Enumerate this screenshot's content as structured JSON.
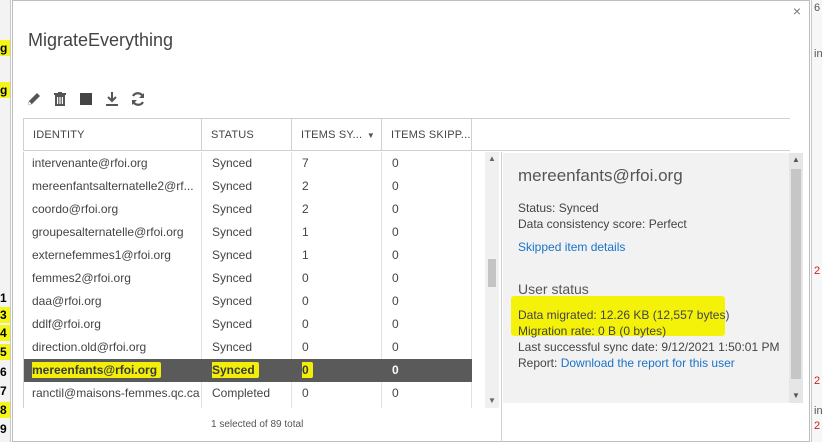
{
  "background": {
    "left_labels": [
      {
        "text": "g",
        "highlight": true
      },
      {
        "text": "g",
        "highlight": true
      },
      {
        "text": "1",
        "highlight": false
      },
      {
        "text": "3",
        "highlight": true
      },
      {
        "text": "4",
        "highlight": true
      },
      {
        "text": "5",
        "highlight": true
      },
      {
        "text": "6",
        "highlight": false
      },
      {
        "text": "7",
        "highlight": false
      },
      {
        "text": "8",
        "highlight": true
      },
      {
        "text": "9",
        "highlight": false
      }
    ],
    "right_labels": [
      "6",
      "in",
      "2",
      "2",
      "in",
      "2"
    ]
  },
  "dialog": {
    "title": "MigrateEverything",
    "close_glyph": "×"
  },
  "toolbar": {
    "icons": [
      "edit-icon",
      "delete-icon",
      "stop-icon",
      "download-icon",
      "refresh-icon"
    ]
  },
  "table": {
    "columns": [
      {
        "label": "IDENTITY"
      },
      {
        "label": "STATUS"
      },
      {
        "label": "ITEMS SY..."
      },
      {
        "label": "ITEMS SKIPP..."
      }
    ],
    "rows": [
      {
        "identity": "intervenante@rfoi.org",
        "status": "Synced",
        "synced": "7",
        "skipped": "0"
      },
      {
        "identity": "mereenfantsalternatelle2@rf...",
        "status": "Synced",
        "synced": "2",
        "skipped": "0"
      },
      {
        "identity": "coordo@rfoi.org",
        "status": "Synced",
        "synced": "2",
        "skipped": "0"
      },
      {
        "identity": "groupesalternatelle@rfoi.org",
        "status": "Synced",
        "synced": "1",
        "skipped": "0"
      },
      {
        "identity": "externefemmes1@rfoi.org",
        "status": "Synced",
        "synced": "1",
        "skipped": "0"
      },
      {
        "identity": "femmes2@rfoi.org",
        "status": "Synced",
        "synced": "0",
        "skipped": "0"
      },
      {
        "identity": "daa@rfoi.org",
        "status": "Synced",
        "synced": "0",
        "skipped": "0"
      },
      {
        "identity": "ddlf@rfoi.org",
        "status": "Synced",
        "synced": "0",
        "skipped": "0"
      },
      {
        "identity": "direction.old@rfoi.org",
        "status": "Synced",
        "synced": "0",
        "skipped": "0"
      },
      {
        "identity": "mereenfants@rfoi.org",
        "status": "Synced",
        "synced": "0",
        "skipped": "0",
        "selected": true
      },
      {
        "identity": "ranctil@maisons-femmes.qc.ca",
        "status": "Completed",
        "synced": "0",
        "skipped": "0"
      }
    ],
    "footer": "1 selected of 89 total"
  },
  "details": {
    "title": "mereenfants@rfoi.org",
    "status": "Status: Synced",
    "consistency": "Data consistency score: Perfect",
    "skipped_link": "Skipped item details",
    "user_status_heading": "User status",
    "data_migrated": "Data migrated: 12.26 KB (12,557 bytes)",
    "migration_rate": "Migration rate: 0 B (0 bytes)",
    "last_sync": "Last successful sync date: 9/12/2021 1:50:01 PM",
    "report_prefix": "Report: ",
    "report_link": "Download the report for this user"
  },
  "colors": {
    "highlight": "#f2ee0a",
    "selected_row": "#5a5a5a",
    "link": "#1a73c8"
  }
}
